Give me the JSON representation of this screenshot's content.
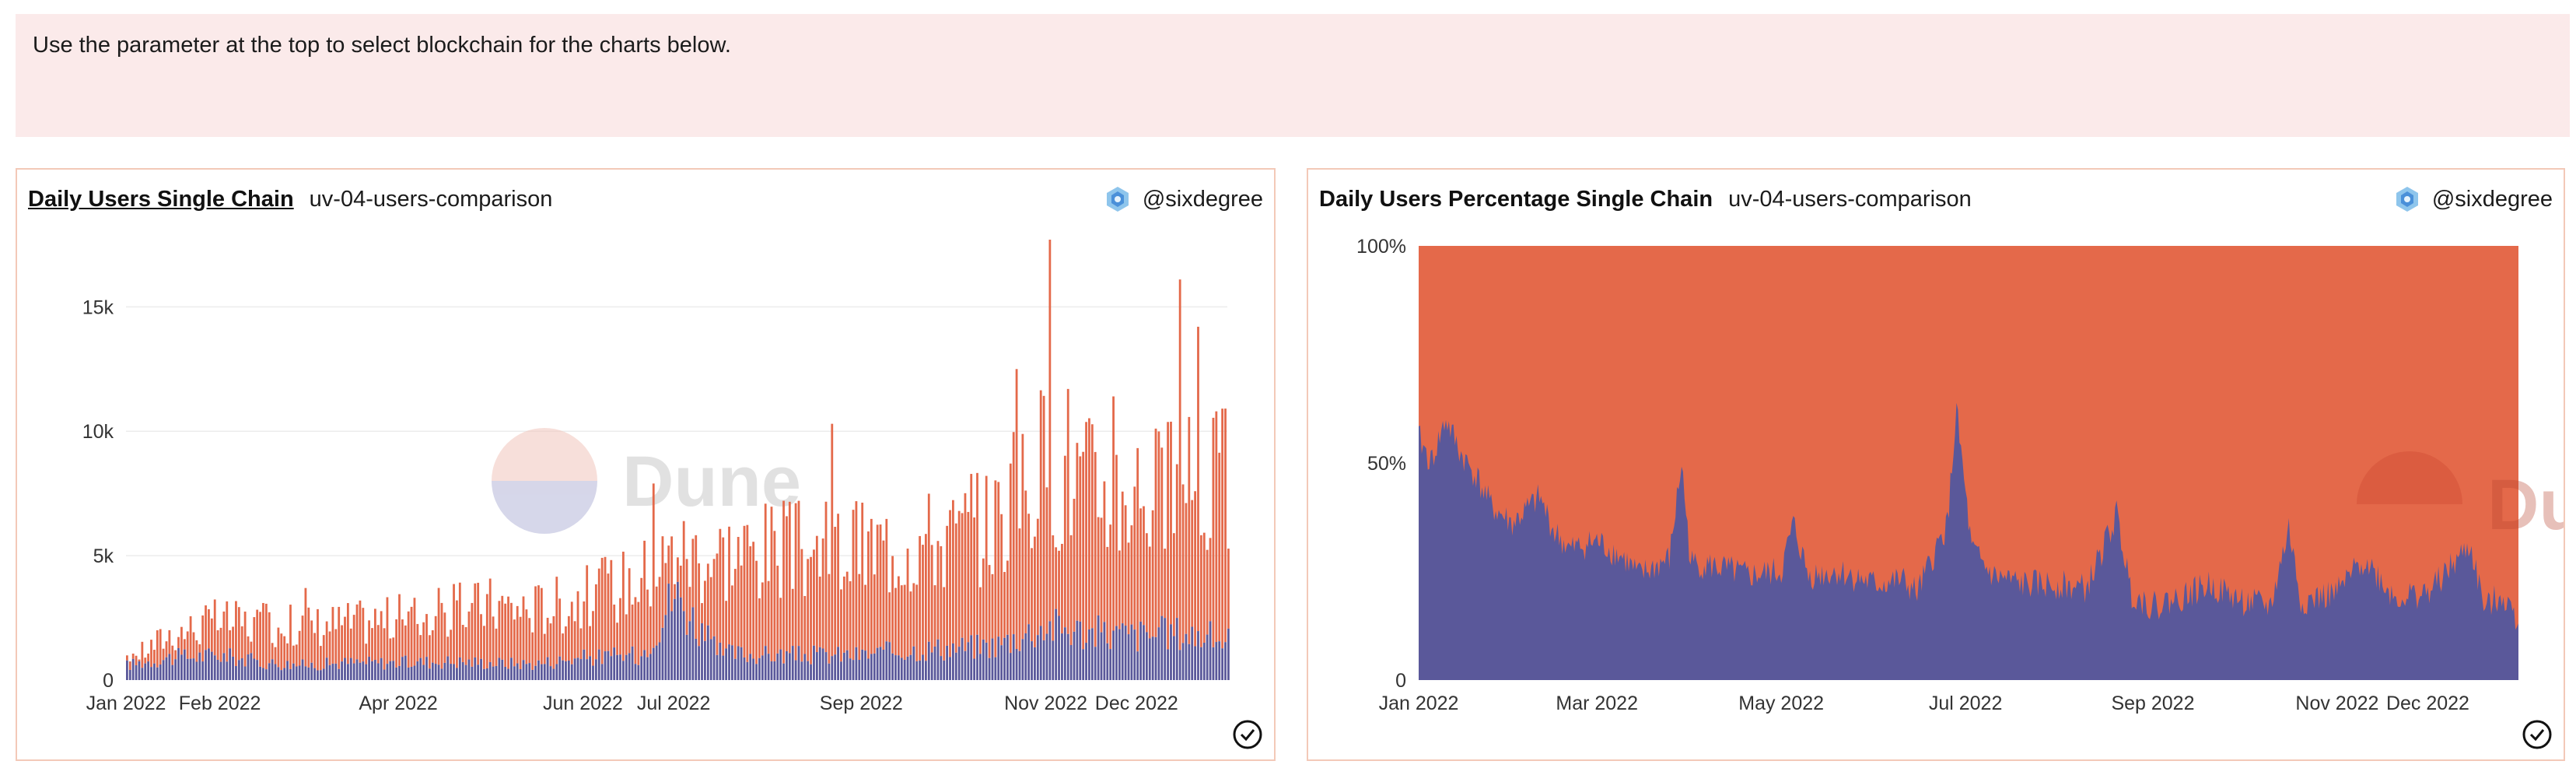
{
  "banner": {
    "text": "Use the parameter at the top to select blockchain for the charts below."
  },
  "cards": [
    {
      "title": "Daily Users Single Chain",
      "query": "uv-04-users-comparison",
      "author": "@sixdegree"
    },
    {
      "title": "Daily Users Percentage Single Chain",
      "query": "uv-04-users-comparison",
      "author": "@sixdegree"
    }
  ],
  "watermark": "Dune",
  "colors": {
    "series_top": "#e4694a",
    "series_bottom": "#5a589a",
    "banner_bg": "#fbeaea",
    "card_border": "#f3c9b8"
  },
  "chart_data": [
    {
      "type": "bar",
      "stacked": true,
      "x_range": [
        "2022-01-01",
        "2022-12-31"
      ],
      "x_tick_labels": [
        "Jan 2022",
        "Feb 2022",
        "Apr 2022",
        "Jun 2022",
        "Jul 2022",
        "Sep 2022",
        "Nov 2022",
        "Dec 2022"
      ],
      "y_tick_labels": [
        "0",
        "5k",
        "10k",
        "15k"
      ],
      "ylim": [
        0,
        17700
      ],
      "grid": true,
      "legend": "none",
      "series": [
        {
          "points": [
            [
              "2022-01-01",
              600
            ],
            [
              "2022-01-15",
              900
            ],
            [
              "2022-02-01",
              1000
            ],
            [
              "2022-02-15",
              700
            ],
            [
              "2022-03-01",
              600
            ],
            [
              "2022-03-15",
              700
            ],
            [
              "2022-04-01",
              700
            ],
            [
              "2022-04-15",
              750
            ],
            [
              "2022-05-01",
              700
            ],
            [
              "2022-05-15",
              650
            ],
            [
              "2022-06-01",
              900
            ],
            [
              "2022-06-20",
              1000
            ],
            [
              "2022-07-01",
              3500
            ],
            [
              "2022-07-15",
              1100
            ],
            [
              "2022-08-01",
              1000
            ],
            [
              "2022-08-15",
              1000
            ],
            [
              "2022-09-01",
              1000
            ],
            [
              "2022-09-15",
              1200
            ],
            [
              "2022-10-01",
              1300
            ],
            [
              "2022-10-15",
              1400
            ],
            [
              "2022-11-01",
              2200
            ],
            [
              "2022-11-15",
              1900
            ],
            [
              "2022-12-01",
              1800
            ],
            [
              "2022-12-15",
              1900
            ],
            [
              "2022-12-31",
              1600
            ]
          ]
        },
        {
          "points": [
            [
              "2022-01-01",
              800
            ],
            [
              "2022-01-15",
              2000
            ],
            [
              "2022-02-01",
              2600
            ],
            [
              "2022-02-15",
              2400
            ],
            [
              "2022-03-01",
              2400
            ],
            [
              "2022-03-15",
              2500
            ],
            [
              "2022-04-01",
              2700
            ],
            [
              "2022-04-15",
              2900
            ],
            [
              "2022-05-01",
              3300
            ],
            [
              "2022-05-15",
              3100
            ],
            [
              "2022-06-01",
              3600
            ],
            [
              "2022-06-20",
              4500
            ],
            [
              "2022-07-01",
              5500
            ],
            [
              "2022-07-15",
              5500
            ],
            [
              "2022-08-01",
              5700
            ],
            [
              "2022-08-15",
              5600
            ],
            [
              "2022-09-01",
              5700
            ],
            [
              "2022-09-15",
              6000
            ],
            [
              "2022-10-01",
              6200
            ],
            [
              "2022-10-15",
              7000
            ],
            [
              "2022-11-01",
              9500
            ],
            [
              "2022-11-15",
              8500
            ],
            [
              "2022-12-01",
              8500
            ],
            [
              "2022-12-15",
              8000
            ],
            [
              "2022-12-31",
              8800
            ]
          ]
        }
      ],
      "spikes": [
        [
          "2022-03-01",
          3700
        ],
        [
          "2022-06-24",
          7900
        ],
        [
          "2022-08-22",
          10300
        ],
        [
          "2022-10-22",
          12500
        ],
        [
          "2022-11-02",
          17700
        ],
        [
          "2022-11-08",
          11700
        ],
        [
          "2022-11-23",
          11400
        ],
        [
          "2022-12-15",
          16100
        ],
        [
          "2022-12-21",
          14200
        ],
        [
          "2022-12-27",
          10800
        ]
      ]
    },
    {
      "type": "area",
      "stacked": true,
      "percent": true,
      "x_range": [
        "2022-01-01",
        "2022-12-31"
      ],
      "x_tick_labels": [
        "Jan 2022",
        "Mar 2022",
        "May 2022",
        "Jul 2022",
        "Sep 2022",
        "Nov 2022",
        "Dec 2022"
      ],
      "y_tick_labels": [
        "0",
        "50%",
        "100%"
      ],
      "ylim": [
        0,
        100
      ],
      "legend": "none",
      "series": [
        {
          "points": [
            [
              "2022-01-01",
              56
            ],
            [
              "2022-01-05",
              50
            ],
            [
              "2022-01-10",
              60
            ],
            [
              "2022-01-15",
              52
            ],
            [
              "2022-01-20",
              47
            ],
            [
              "2022-01-25",
              40
            ],
            [
              "2022-02-01",
              36
            ],
            [
              "2022-02-10",
              42
            ],
            [
              "2022-02-15",
              34
            ],
            [
              "2022-02-20",
              30
            ],
            [
              "2022-03-01",
              32
            ],
            [
              "2022-03-10",
              28
            ],
            [
              "2022-03-15",
              24
            ],
            [
              "2022-03-25",
              28
            ],
            [
              "2022-03-29",
              50
            ],
            [
              "2022-04-01",
              27
            ],
            [
              "2022-04-10",
              26
            ],
            [
              "2022-04-20",
              24
            ],
            [
              "2022-05-01",
              25
            ],
            [
              "2022-05-05",
              36
            ],
            [
              "2022-05-10",
              24
            ],
            [
              "2022-05-20",
              25
            ],
            [
              "2022-06-01",
              22
            ],
            [
              "2022-06-10",
              23
            ],
            [
              "2022-06-15",
              20
            ],
            [
              "2022-06-25",
              36
            ],
            [
              "2022-06-28",
              62
            ],
            [
              "2022-07-03",
              30
            ],
            [
              "2022-07-10",
              24
            ],
            [
              "2022-07-20",
              22
            ],
            [
              "2022-08-01",
              22
            ],
            [
              "2022-08-10",
              21
            ],
            [
              "2022-08-20",
              38
            ],
            [
              "2022-08-25",
              20
            ],
            [
              "2022-09-01",
              17
            ],
            [
              "2022-09-10",
              19
            ],
            [
              "2022-09-20",
              22
            ],
            [
              "2022-10-01",
              18
            ],
            [
              "2022-10-10",
              17
            ],
            [
              "2022-10-16",
              35
            ],
            [
              "2022-10-20",
              18
            ],
            [
              "2022-11-01",
              20
            ],
            [
              "2022-11-10",
              28
            ],
            [
              "2022-11-20",
              19
            ],
            [
              "2022-12-01",
              20
            ],
            [
              "2022-12-10",
              27
            ],
            [
              "2022-12-15",
              31
            ],
            [
              "2022-12-20",
              16
            ],
            [
              "2022-12-25",
              20
            ],
            [
              "2022-12-31",
              14
            ]
          ]
        },
        {
          "points": [
            [
              "2022-01-01",
              44
            ],
            [
              "2022-03-01",
              68
            ],
            [
              "2022-05-01",
              75
            ],
            [
              "2022-07-01",
              78
            ],
            [
              "2022-09-01",
              83
            ],
            [
              "2022-11-01",
              80
            ],
            [
              "2022-12-31",
              86
            ]
          ]
        }
      ]
    }
  ]
}
